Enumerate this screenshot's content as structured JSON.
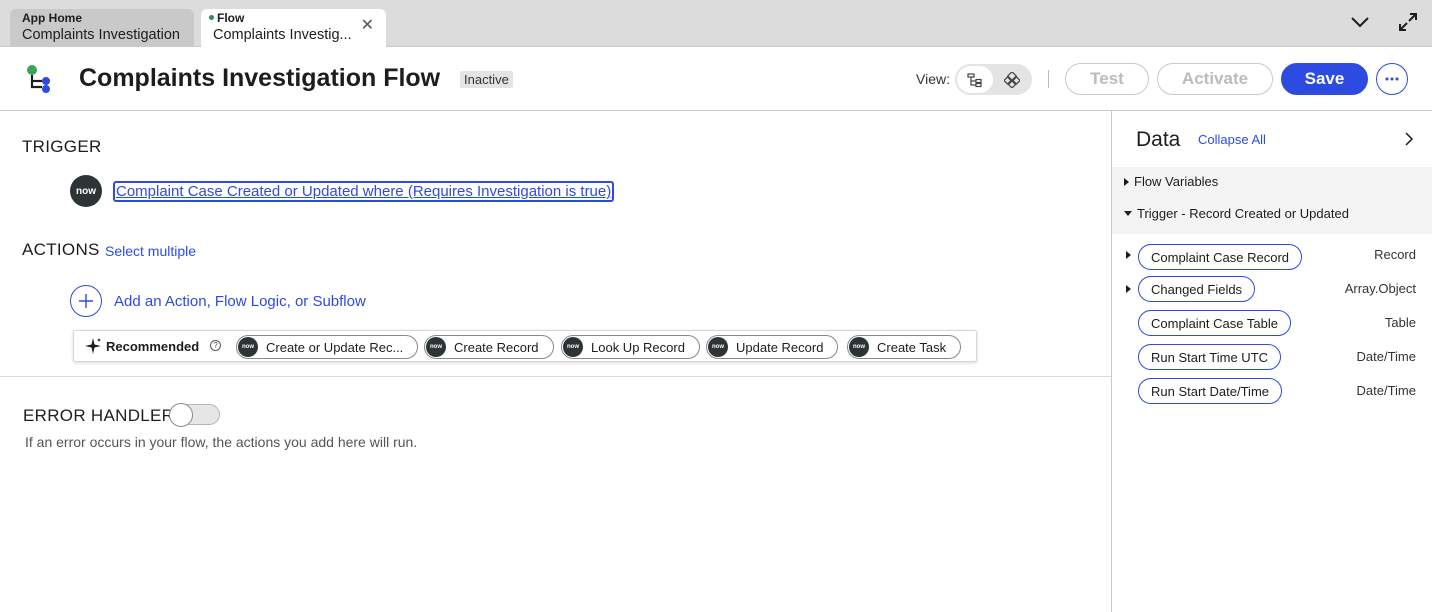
{
  "tabs": [
    {
      "app": "App Home",
      "label": "Complaints Investigation",
      "active": false
    },
    {
      "app": "Flow",
      "label": "Complaints Investig...",
      "active": true,
      "unsaved_dot_color": "#2e8b57"
    }
  ],
  "tab_controls": {
    "chevron_icon": "chevron-down-icon",
    "expand_icon": "expand-icon",
    "close_icon": "close-icon"
  },
  "header": {
    "title": "Complaints Investigation Flow",
    "status": "Inactive",
    "view_label": "View:",
    "view_options": [
      "tree-view-icon",
      "diagram-view-icon"
    ],
    "buttons": {
      "test": "Test",
      "activate": "Activate",
      "save": "Save",
      "more": "···"
    }
  },
  "trigger": {
    "section_label": "TRIGGER",
    "badge": "now",
    "description": "Complaint Case Created or Updated where (Requires Investigation is true)"
  },
  "actions": {
    "section_label": "ACTIONS",
    "select_multiple": "Select multiple",
    "add_label": "Add an Action, Flow Logic, or Subflow",
    "recommended_label": "Recommended",
    "recommended_help": "?",
    "recommended": [
      "Create or Update Rec...",
      "Create Record",
      "Look Up Record",
      "Update Record",
      "Create Task"
    ]
  },
  "error_handler": {
    "section_label": "ERROR HANDLER",
    "enabled": false,
    "description": "If an error occurs in your flow, the actions you add here will run."
  },
  "data_panel": {
    "title": "Data",
    "collapse_all": "Collapse All",
    "groups": [
      {
        "label": "Flow Variables",
        "expanded": false
      },
      {
        "label": "Trigger - Record Created or Updated",
        "expanded": true
      }
    ],
    "pills": [
      {
        "label": "Complaint Case Record",
        "type": "Record",
        "expandable": true
      },
      {
        "label": "Changed Fields",
        "type": "Array.Object",
        "expandable": true
      },
      {
        "label": "Complaint Case Table",
        "type": "Table",
        "expandable": false
      },
      {
        "label": "Run Start Time UTC",
        "type": "Date/Time",
        "expandable": false
      },
      {
        "label": "Run Start Date/Time",
        "type": "Date/Time",
        "expandable": false
      }
    ]
  },
  "colors": {
    "accent": "#2d4be0",
    "tabbar": "#dcdcdc",
    "logo_green": "#3aa655",
    "logo_blue": "#2d4be0"
  }
}
